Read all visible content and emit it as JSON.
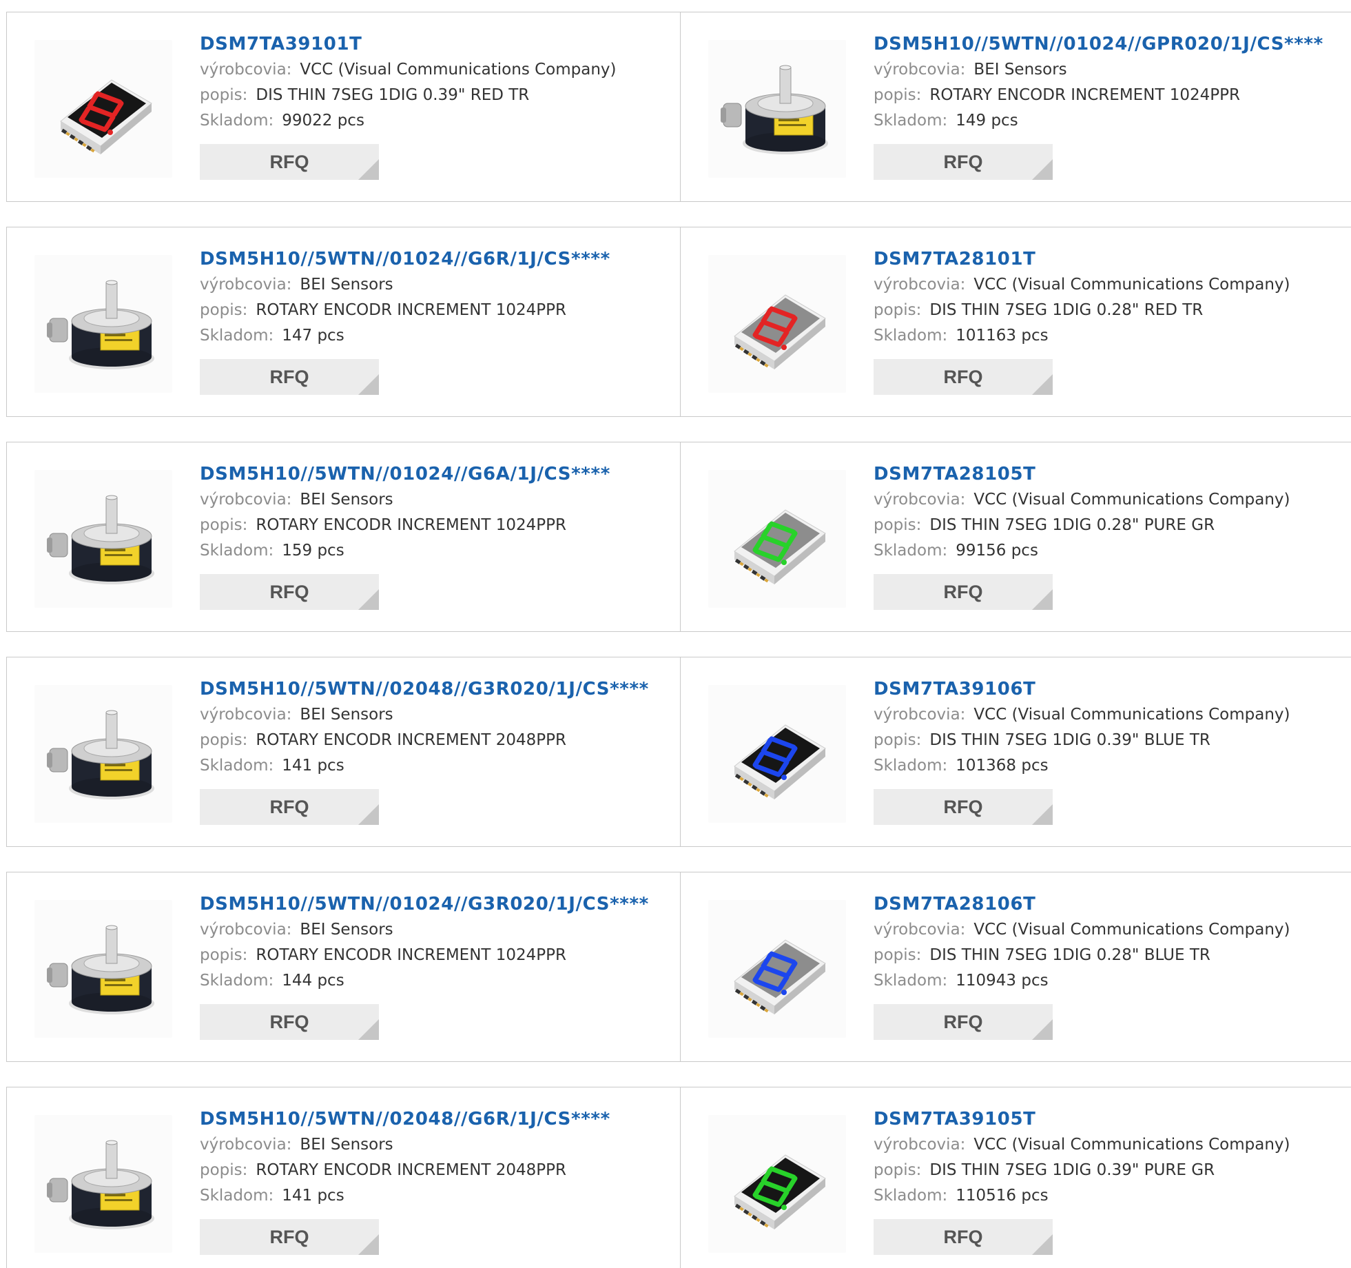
{
  "labels": {
    "manufacturer": "výrobcovia:",
    "description": "popis:",
    "stock": "Skladom:",
    "rfq": "RFQ"
  },
  "colors": {
    "title": "#1a62ad",
    "label": "#8c8c8c",
    "value": "#333333",
    "border": "#c9c9c9",
    "button_bg": "#ececec",
    "button_corner": "#c6c6c6"
  },
  "products": [
    {
      "part": "DSM7TA39101T",
      "manufacturer": "VCC (Visual Communications Company)",
      "description": "DIS THIN 7SEG 1DIG 0.39\" RED TR",
      "stock": "99022 pcs",
      "image": "seven-segment-display-red-large-icon"
    },
    {
      "part": "DSM5H10//5WTN//01024//GPR020/1J/CS****",
      "manufacturer": "BEI Sensors",
      "description": "ROTARY ENCODR INCREMENT 1024PPR",
      "stock": "149 pcs",
      "image": "rotary-encoder-icon"
    },
    {
      "part": "DSM5H10//5WTN//01024//G6R/1J/CS****",
      "manufacturer": "BEI Sensors",
      "description": "ROTARY ENCODR INCREMENT 1024PPR",
      "stock": "147 pcs",
      "image": "rotary-encoder-icon"
    },
    {
      "part": "DSM7TA28101T",
      "manufacturer": "VCC (Visual Communications Company)",
      "description": "DIS THIN 7SEG 1DIG 0.28\" RED TR",
      "stock": "101163 pcs",
      "image": "seven-segment-display-red-small-icon"
    },
    {
      "part": "DSM5H10//5WTN//01024//G6A/1J/CS****",
      "manufacturer": "BEI Sensors",
      "description": "ROTARY ENCODR INCREMENT 1024PPR",
      "stock": "159 pcs",
      "image": "rotary-encoder-icon"
    },
    {
      "part": "DSM7TA28105T",
      "manufacturer": "VCC (Visual Communications Company)",
      "description": "DIS THIN 7SEG 1DIG 0.28\" PURE GR",
      "stock": "99156 pcs",
      "image": "seven-segment-display-green-small-icon"
    },
    {
      "part": "DSM5H10//5WTN//02048//G3R020/1J/CS****",
      "manufacturer": "BEI Sensors",
      "description": "ROTARY ENCODR INCREMENT 2048PPR",
      "stock": "141 pcs",
      "image": "rotary-encoder-icon"
    },
    {
      "part": "DSM7TA39106T",
      "manufacturer": "VCC (Visual Communications Company)",
      "description": "DIS THIN 7SEG 1DIG 0.39\" BLUE TR",
      "stock": "101368 pcs",
      "image": "seven-segment-display-blue-large-icon"
    },
    {
      "part": "DSM5H10//5WTN//01024//G3R020/1J/CS****",
      "manufacturer": "BEI Sensors",
      "description": "ROTARY ENCODR INCREMENT 1024PPR",
      "stock": "144 pcs",
      "image": "rotary-encoder-icon"
    },
    {
      "part": "DSM7TA28106T",
      "manufacturer": "VCC (Visual Communications Company)",
      "description": "DIS THIN 7SEG 1DIG 0.28\" BLUE TR",
      "stock": "110943 pcs",
      "image": "seven-segment-display-blue-small-icon"
    },
    {
      "part": "DSM5H10//5WTN//02048//G6R/1J/CS****",
      "manufacturer": "BEI Sensors",
      "description": "ROTARY ENCODR INCREMENT 2048PPR",
      "stock": "141 pcs",
      "image": "rotary-encoder-icon"
    },
    {
      "part": "DSM7TA39105T",
      "manufacturer": "VCC (Visual Communications Company)",
      "description": "DIS THIN 7SEG 1DIG 0.39\" PURE GR",
      "stock": "110516 pcs",
      "image": "seven-segment-display-green-large-icon"
    }
  ]
}
